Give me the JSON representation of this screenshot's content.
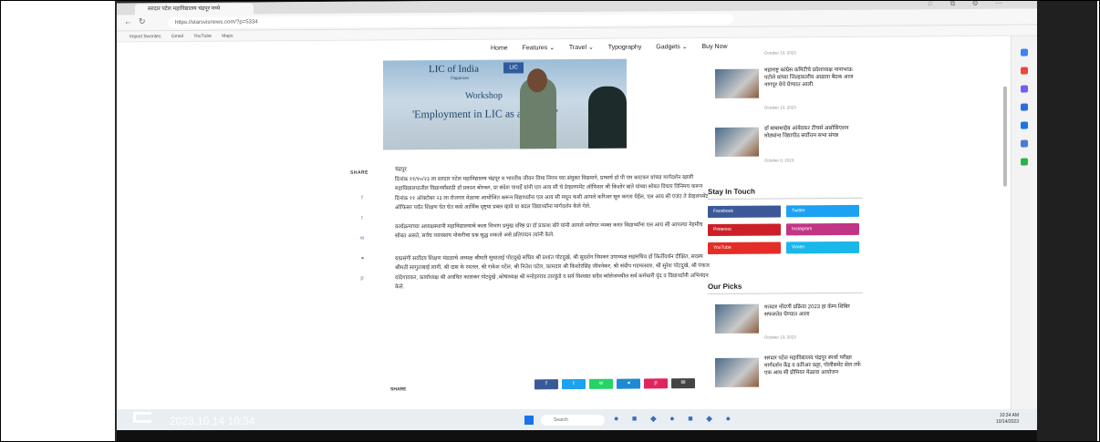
{
  "browser": {
    "tab_title": "सरदार पटेल महाविद्यालय चंद्रपूर मध्ये",
    "url": "https://starsvisnews.com/?p=5334",
    "bookmarks": [
      "Import favorites",
      "Gmail",
      "YouTube",
      "Maps"
    ]
  },
  "site_nav": [
    "Home",
    "Features ⌄",
    "Travel ⌄",
    "Typography",
    "Gadgets ⌄",
    "Buy Now"
  ],
  "hero": {
    "org": "LIC of India",
    "organizer": "Organizes",
    "workshop": "Workshop",
    "title": "'Employment in LIC as an Agent'",
    "logo": "LIC"
  },
  "share_label": "SHARE",
  "share_icons": [
    "f",
    "t",
    "w",
    "◂",
    "p"
  ],
  "article": {
    "p1": "चंद्रपूर\nदिनांक ११/१०/२३ ला सरदार पटेल महाविद्यालय चंद्रपूर व भारतीय जीवन विमा निगम च्या संयुक्त विद्यमाने, प्राचार्य डॉ पी एम काटकर यांच्या मार्गदर्शन खाली महाविद्यालयातील विद्यार्थ्यांसाठी डॉ प्रकाश बोरकर, प्रा संदेश पाथर्डे यांनी एल आय सी चे डेव्हलपमेंट ऑफिसर श्री किशोर बाते यांच्या सोबत विचार विनिमय करून दिनांक ११ ऑक्टोबर २३ ला रोजगार मेळावा आयोजित करून विद्यार्थ्यांना एल आय सी मधून कशी आपले करिअर सुरु करता येईल, एल आय सी एजंट ते डेव्हलपमेंट ऑफिसर पर्यंत शिक्षण घेत घेत कसे आर्थिक दृष्ट्या प्रबल व्हावे या बदल विद्यार्थ्यांना मार्गदर्शन केले गेले.",
    "p2": "कार्यक्रमाच्या अध्यक्षस्थानी महाविद्यालयाचे कला विभाग प्रमुख वरिष्ठ प्रा डॉ प्रकाश बोरे यांनी आपले मनोगत व्यक्त करत विद्यार्थ्यांना एल आय सी आपल्या नेहमीच सोबत असते, सर्वच व्यावसाय नोकरीचा प्रश्न सुद्ध शकतो असे प्रतिपादन त्यांनी केले.",
    "p3": "याप्रसंगी सर्वोदय शिक्षण मंडळाचे अध्यक्ष श्रीमती सुधाताई पोटदुखे सचिव श्री प्रशांत पोटदुखे, श्री सुदर्शन निमकर उपाध्यक्ष सहसचिव डॉ किर्तीवर्धन दीक्षित, सदस्य श्रीमती सागुताबाई लागी, श्री दास के रमतल, श्री राकेश पटेल, श्री नितेश पटेल, कामदार श्री किशोरसिंह जीवनेकर, श्री संदीप गडमलवार, श्री सुरेश पोटदुखे, श्री पंकज वांदेगावकर, कार्याध्यक्ष श्री अवधित कालकर पोटदुखे ,कोषाध्यक्ष श्री मनोहरराव तारकुंडे व सर्व विश्वस्त सदैव कॉलेजमधील सर्व कर्मचारी वृंद व विद्यार्थ्यांनी अभिनंदन केले."
  },
  "share_bottom": [
    {
      "label": "f",
      "color": "#3b5998"
    },
    {
      "label": "t",
      "color": "#1da1f2"
    },
    {
      "label": "w",
      "color": "#25d366"
    },
    {
      "label": "◂",
      "color": "#1f8ad3"
    },
    {
      "label": "p",
      "color": "#e0245e"
    },
    {
      "label": "✉",
      "color": "#444444"
    }
  ],
  "sidebar": {
    "top_date": "October 13, 2023",
    "items": [
      {
        "title": "महाराष्ट्र कांग्रेस कमिटीचे प्रदेशाध्यक्ष नानाभाऊ पटोले यांच्या जिल्हास्तरीय आढावा बैठक आज नागपूर येथे घेण्यात आली.",
        "date": "October 13, 2023"
      },
      {
        "title": "डॉ बाबासाहेब आंबेडकर टीचर्स असोसिएशन मोठ्यांना विद्यापीठ सर्वोत्तम सभा संपन्न",
        "date": "October 8, 2023"
      }
    ],
    "stay_in_touch": "Stay In Touch",
    "social": [
      {
        "label": "Facebook",
        "color": "#3b5998"
      },
      {
        "label": "Twitter",
        "color": "#1da1f2"
      },
      {
        "label": "Pinterest",
        "color": "#cb2027"
      },
      {
        "label": "Instagram",
        "color": "#c13584"
      },
      {
        "label": "YouTube",
        "color": "#e52d27"
      },
      {
        "label": "Vimeo",
        "color": "#1ab7ea"
      }
    ],
    "our_picks": "Our Picks",
    "picks": [
      {
        "title": "मतदार नोंदणी प्रक्रिया 2023 हा कॅम्प शिबिर सफलतेत घेण्यात आला",
        "date": "October 13, 2023"
      },
      {
        "title": "सरदार पटेल महाविद्यालय चंद्रपूर स्पर्धा परीक्षा मार्गदर्शन केंद्र व करिअर कट्टा, पोलीसमेंट सेल तर्फे एक आय सी प्रीमियर मेळावा आयोजन",
        "date": ""
      }
    ]
  },
  "taskbar": {
    "search": "Search",
    "time": "10:34 AM",
    "date": "10/14/2023",
    "lang": "ENG IN"
  },
  "watermark": {
    "model": "OPPO F21s",
    "model_suffix": "Pro",
    "datetime": "2023.10.14 10:34"
  }
}
